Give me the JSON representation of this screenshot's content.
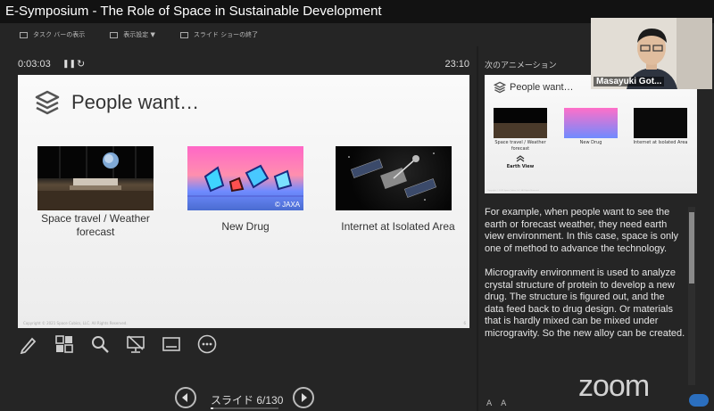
{
  "window": {
    "title": "E-Symposium - The Role of Space in Sustainable Development"
  },
  "toolbar": {
    "items": [
      {
        "label": "タスク バーの表示",
        "icon": "taskbar-icon"
      },
      {
        "label": "表示設定 ▼",
        "icon": "display-settings-icon"
      },
      {
        "label": "スライド ショーの終了",
        "icon": "end-show-icon"
      }
    ]
  },
  "timer": {
    "elapsed": "0:03:03",
    "pause_icon": "❚❚",
    "reset_icon": "↻",
    "clock": "23:10"
  },
  "slide": {
    "title": "People want…",
    "items": [
      {
        "caption": "Space travel / Weather forecast"
      },
      {
        "caption": "New Drug",
        "credit": "© JAXA"
      },
      {
        "caption": "Internet at Isolated Area"
      }
    ],
    "copyright": "Copyright © 2021 Space Cubics, LLC. All Rights Reserved.",
    "page": "6"
  },
  "next": {
    "label": "次のアニメーション",
    "title": "People want…",
    "captions": [
      "Space travel / Weather forecast",
      "New Drug",
      "Internet at Isolated Area"
    ],
    "earth_view": "Earth View"
  },
  "notes": {
    "p1": "For example, when people want to see the earth or forecast weather, they need earth view environment. In this case, space is only one of method to advance the technology.",
    "p2": "Microgravity environment is used to analyze crystal structure of protein to develop a new drug. The structure is figured out, and the data feed back to drug design. Or materials that is hardly mixed can be mixed under microgravity. So the new alloy can be created."
  },
  "navigation": {
    "label": "スライド 6/130",
    "progress": 0.046
  },
  "font_controls": {
    "larger": "A",
    "smaller": "A"
  },
  "video": {
    "name": "Masayuki Got..."
  },
  "watermark": "zoom",
  "colors": {
    "background": "#252525",
    "titlebar": "#121212",
    "slide_bg": "#f5f5f5",
    "text_light": "#e6e6e6"
  }
}
